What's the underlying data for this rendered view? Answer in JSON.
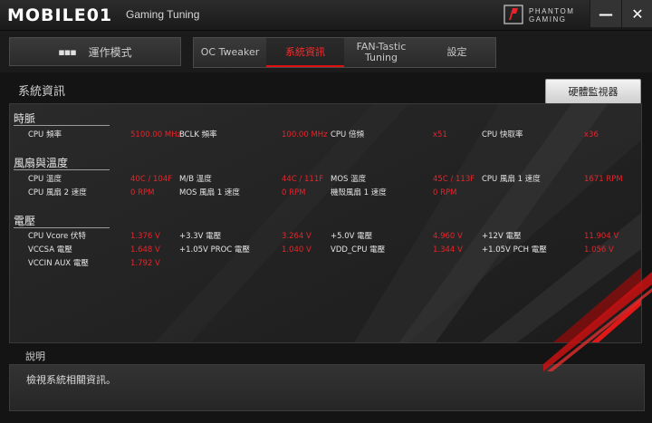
{
  "header": {
    "logo_text": "MOBILE01",
    "app_title": "Gaming Tuning",
    "brand_line1": "PHANTOM",
    "brand_line2": "GAMING",
    "minimize_label": "—",
    "close_label": "✕"
  },
  "nav": {
    "mode_button": "運作模式",
    "tabs": [
      {
        "label": "OC Tweaker",
        "active": false
      },
      {
        "label": "系統資訊",
        "active": true
      },
      {
        "label": "FAN-Tastic Tuning",
        "active": false
      },
      {
        "label": "設定",
        "active": false
      }
    ]
  },
  "page": {
    "title": "系統資訊",
    "hw_monitor_button": "硬體監視器"
  },
  "sections": {
    "clock": {
      "title": "時脈",
      "rows": [
        [
          {
            "label": "CPU 頻率",
            "value": "5100.00 MHz"
          },
          {
            "label": "BCLK 頻率",
            "value": "100.00 MHz"
          },
          {
            "label": "CPU 倍頻",
            "value": "x51"
          },
          {
            "label": "CPU 快取率",
            "value": "x36"
          }
        ]
      ]
    },
    "fan_temp": {
      "title": "風扇與溫度",
      "rows": [
        [
          {
            "label": "CPU 溫度",
            "value": "40C / 104F"
          },
          {
            "label": "M/B 溫度",
            "value": "44C / 111F"
          },
          {
            "label": "MOS 溫度",
            "value": "45C / 113F"
          },
          {
            "label": "CPU 風扇 1 速度",
            "value": "1671 RPM"
          }
        ],
        [
          {
            "label": "CPU 風扇 2 速度",
            "value": "0 RPM"
          },
          {
            "label": "MOS 風扇 1 速度",
            "value": "0 RPM"
          },
          {
            "label": "機殼風扇 1 速度",
            "value": "0 RPM"
          }
        ]
      ]
    },
    "voltage": {
      "title": "電壓",
      "rows": [
        [
          {
            "label": "CPU Vcore 伏特",
            "value": "1.376 V"
          },
          {
            "label": "+3.3V 電壓",
            "value": "3.264 V"
          },
          {
            "label": "+5.0V 電壓",
            "value": "4.960 V"
          },
          {
            "label": "+12V 電壓",
            "value": "11.904 V"
          }
        ],
        [
          {
            "label": "VCCSA 電壓",
            "value": "1.648 V"
          },
          {
            "label": "+1.05V PROC 電壓",
            "value": "1.040 V"
          },
          {
            "label": "VDD_CPU 電壓",
            "value": "1.344 V"
          },
          {
            "label": "+1.05V PCH 電壓",
            "value": "1.056 V"
          }
        ],
        [
          {
            "label": "VCCIN AUX 電壓",
            "value": "1.792 V"
          }
        ]
      ]
    }
  },
  "description": {
    "title": "說明",
    "text": "檢視系統相關資訊。"
  },
  "colors": {
    "accent": "#e8242a",
    "background": "#141414"
  }
}
